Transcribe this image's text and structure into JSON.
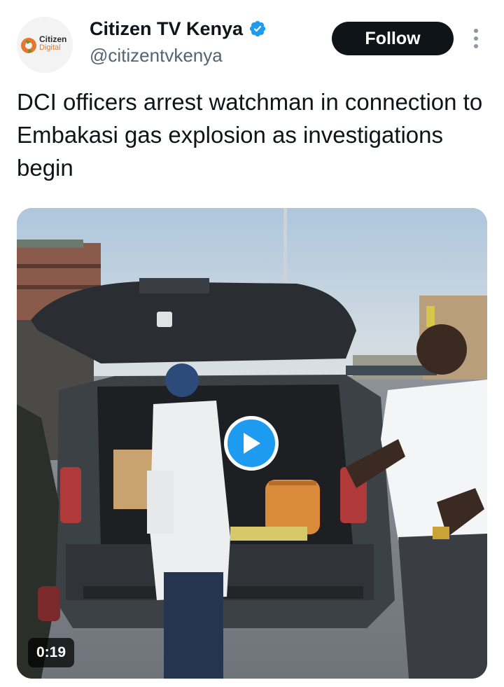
{
  "author": {
    "display_name": "Citizen TV Kenya",
    "handle": "@citizentvkenya",
    "verified": true,
    "avatar": {
      "logo_line1": "Citizen",
      "logo_line2": "Digital"
    }
  },
  "actions": {
    "follow_label": "Follow",
    "more_icon": "more-vertical-icon"
  },
  "tweet": {
    "text": "DCI officers arrest watchman in connection to Embakasi gas explosion as investigations begin"
  },
  "media": {
    "type": "video",
    "duration": "0:19",
    "play_icon": "play-icon"
  },
  "colors": {
    "follow_bg": "#0f1419",
    "verified_blue": "#1d9bf0",
    "play_blue": "#1d9bf0",
    "handle_gray": "#536471"
  }
}
